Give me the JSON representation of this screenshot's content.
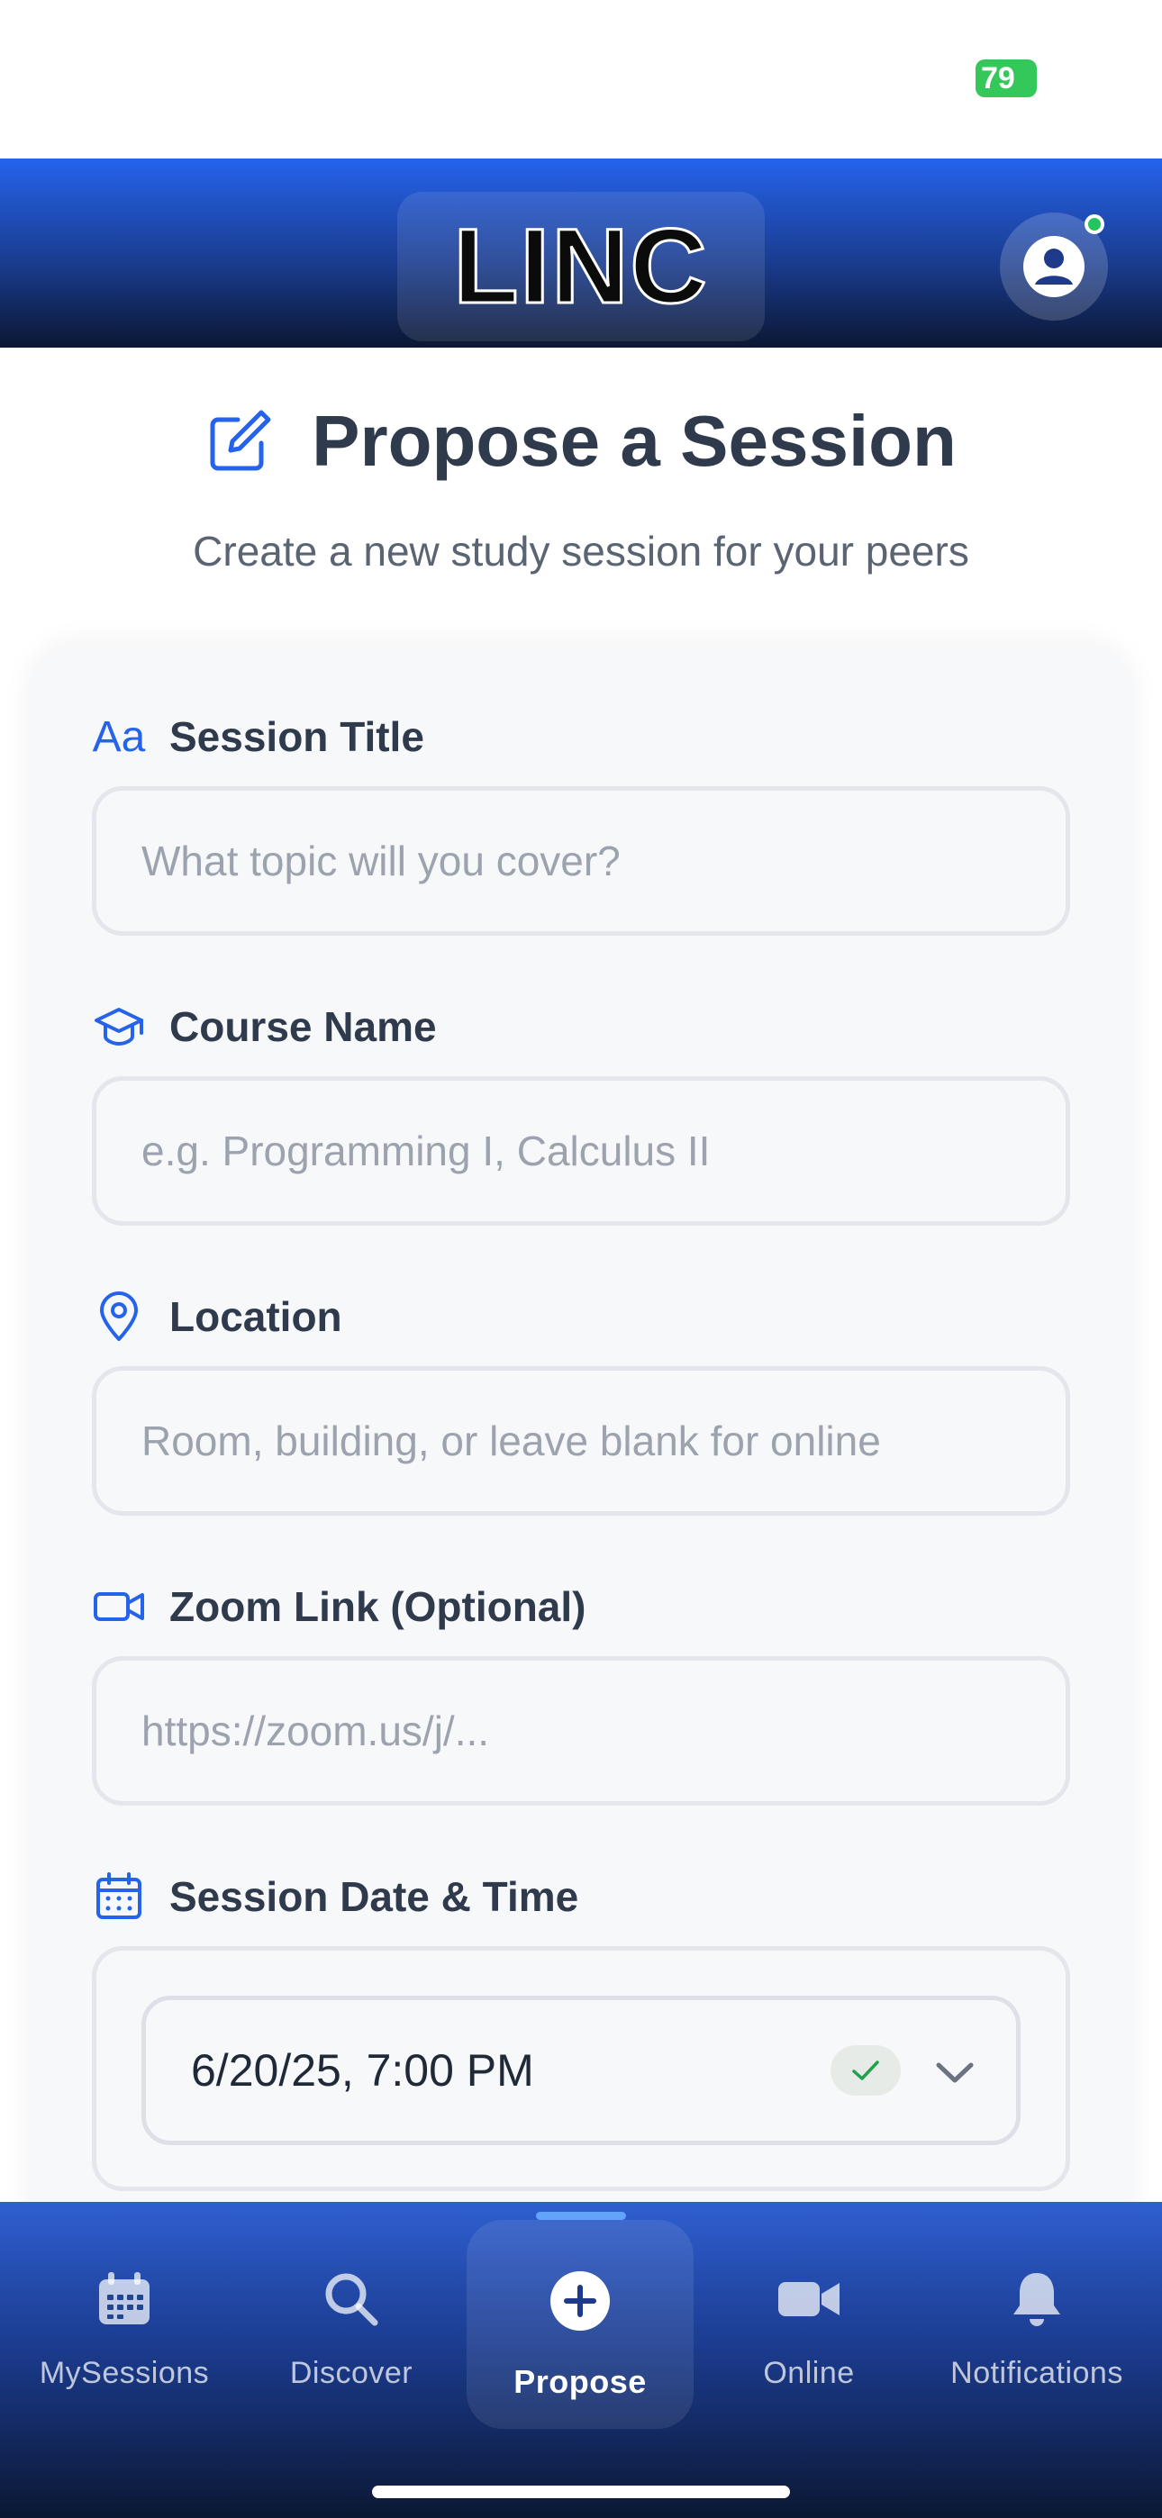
{
  "status_bar": {
    "battery": "79"
  },
  "header": {
    "logo": "LINC"
  },
  "page": {
    "title": "Propose a Session",
    "subtitle": "Create a new study session for your peers"
  },
  "form": {
    "session_title": {
      "label": "Session Title",
      "icon": "text-aa-icon",
      "placeholder": "What topic will you cover?",
      "value": ""
    },
    "course_name": {
      "label": "Course Name",
      "icon": "graduation-cap-icon",
      "placeholder": "e.g. Programming I, Calculus II",
      "value": ""
    },
    "location": {
      "label": "Location",
      "icon": "map-pin-icon",
      "placeholder": "Room, building, or leave blank for online",
      "value": ""
    },
    "zoom_link": {
      "label": "Zoom Link (Optional)",
      "icon": "video-camera-icon",
      "placeholder": "https://zoom.us/j/...",
      "value": ""
    },
    "session_datetime": {
      "label": "Session Date & Time",
      "icon": "calendar-icon",
      "value": "6/20/25, 7:00 PM"
    }
  },
  "tab_bar": {
    "active": "Propose",
    "tabs": [
      {
        "label": "MySessions",
        "icon": "calendar-icon"
      },
      {
        "label": "Discover",
        "icon": "search-icon"
      },
      {
        "label": "Propose",
        "icon": "plus-circle-icon"
      },
      {
        "label": "Online",
        "icon": "video-camera-icon"
      },
      {
        "label": "Notifications",
        "icon": "bell-icon"
      }
    ]
  },
  "colors": {
    "accent": "#2563eb",
    "header_dark": "#0b1733",
    "battery": "#34c759",
    "online_dot": "#22c55e"
  }
}
